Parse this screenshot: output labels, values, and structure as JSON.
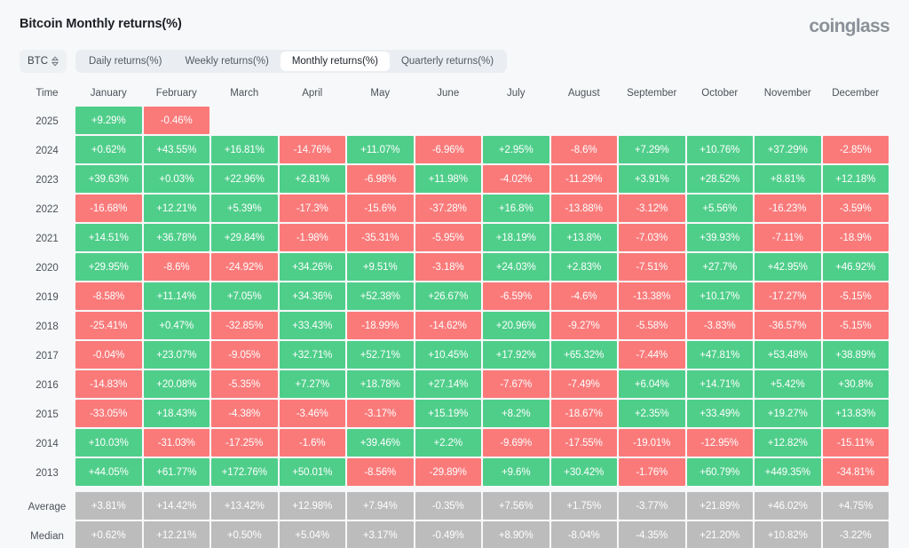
{
  "header": {
    "title": "Bitcoin Monthly returns(%)",
    "brand": "coinglass"
  },
  "controls": {
    "symbol": "BTC",
    "symbol_icon": "updown-chevron-icon",
    "tabs": [
      {
        "label": "Daily returns(%)",
        "active": false
      },
      {
        "label": "Weekly returns(%)",
        "active": false
      },
      {
        "label": "Monthly returns(%)",
        "active": true
      },
      {
        "label": "Quarterly returns(%)",
        "active": false
      }
    ]
  },
  "colors": {
    "positive": "#4fce8a",
    "negative": "#fa7a7a",
    "neutral": "#bcbcbc",
    "background": "#f7f8f9",
    "text": "#4b525a"
  },
  "table": {
    "columns": [
      "Time",
      "January",
      "February",
      "March",
      "April",
      "May",
      "June",
      "July",
      "August",
      "September",
      "October",
      "November",
      "December"
    ],
    "rows": [
      {
        "label": "2025",
        "type": "year",
        "values": [
          "+9.29%",
          "-0.46%",
          "",
          "",
          "",
          "",
          "",
          "",
          "",
          "",
          "",
          ""
        ]
      },
      {
        "label": "2024",
        "type": "year",
        "values": [
          "+0.62%",
          "+43.55%",
          "+16.81%",
          "-14.76%",
          "+11.07%",
          "-6.96%",
          "+2.95%",
          "-8.6%",
          "+7.29%",
          "+10.76%",
          "+37.29%",
          "-2.85%"
        ]
      },
      {
        "label": "2023",
        "type": "year",
        "values": [
          "+39.63%",
          "+0.03%",
          "+22.96%",
          "+2.81%",
          "-6.98%",
          "+11.98%",
          "-4.02%",
          "-11.29%",
          "+3.91%",
          "+28.52%",
          "+8.81%",
          "+12.18%"
        ]
      },
      {
        "label": "2022",
        "type": "year",
        "values": [
          "-16.68%",
          "+12.21%",
          "+5.39%",
          "-17.3%",
          "-15.6%",
          "-37.28%",
          "+16.8%",
          "-13.88%",
          "-3.12%",
          "+5.56%",
          "-16.23%",
          "-3.59%"
        ]
      },
      {
        "label": "2021",
        "type": "year",
        "values": [
          "+14.51%",
          "+36.78%",
          "+29.84%",
          "-1.98%",
          "-35.31%",
          "-5.95%",
          "+18.19%",
          "+13.8%",
          "-7.03%",
          "+39.93%",
          "-7.11%",
          "-18.9%"
        ]
      },
      {
        "label": "2020",
        "type": "year",
        "values": [
          "+29.95%",
          "-8.6%",
          "-24.92%",
          "+34.26%",
          "+9.51%",
          "-3.18%",
          "+24.03%",
          "+2.83%",
          "-7.51%",
          "+27.7%",
          "+42.95%",
          "+46.92%"
        ]
      },
      {
        "label": "2019",
        "type": "year",
        "values": [
          "-8.58%",
          "+11.14%",
          "+7.05%",
          "+34.36%",
          "+52.38%",
          "+26.67%",
          "-6.59%",
          "-4.6%",
          "-13.38%",
          "+10.17%",
          "-17.27%",
          "-5.15%"
        ]
      },
      {
        "label": "2018",
        "type": "year",
        "values": [
          "-25.41%",
          "+0.47%",
          "-32.85%",
          "+33.43%",
          "-18.99%",
          "-14.62%",
          "+20.96%",
          "-9.27%",
          "-5.58%",
          "-3.83%",
          "-36.57%",
          "-5.15%"
        ]
      },
      {
        "label": "2017",
        "type": "year",
        "values": [
          "-0.04%",
          "+23.07%",
          "-9.05%",
          "+32.71%",
          "+52.71%",
          "+10.45%",
          "+17.92%",
          "+65.32%",
          "-7.44%",
          "+47.81%",
          "+53.48%",
          "+38.89%"
        ]
      },
      {
        "label": "2016",
        "type": "year",
        "values": [
          "-14.83%",
          "+20.08%",
          "-5.35%",
          "+7.27%",
          "+18.78%",
          "+27.14%",
          "-7.67%",
          "-7.49%",
          "+6.04%",
          "+14.71%",
          "+5.42%",
          "+30.8%"
        ]
      },
      {
        "label": "2015",
        "type": "year",
        "values": [
          "-33.05%",
          "+18.43%",
          "-4.38%",
          "-3.46%",
          "-3.17%",
          "+15.19%",
          "+8.2%",
          "-18.67%",
          "+2.35%",
          "+33.49%",
          "+19.27%",
          "+13.83%"
        ]
      },
      {
        "label": "2014",
        "type": "year",
        "values": [
          "+10.03%",
          "-31.03%",
          "-17.25%",
          "-1.6%",
          "+39.46%",
          "+2.2%",
          "-9.69%",
          "-17.55%",
          "-19.01%",
          "-12.95%",
          "+12.82%",
          "-15.11%"
        ]
      },
      {
        "label": "2013",
        "type": "year",
        "values": [
          "+44.05%",
          "+61.77%",
          "+172.76%",
          "+50.01%",
          "-8.56%",
          "-29.89%",
          "+9.6%",
          "+30.42%",
          "-1.76%",
          "+60.79%",
          "+449.35%",
          "-34.81%"
        ]
      },
      {
        "label": "Average",
        "type": "summary",
        "values": [
          "+3.81%",
          "+14.42%",
          "+13.42%",
          "+12.98%",
          "+7.94%",
          "-0.35%",
          "+7.56%",
          "+1.75%",
          "-3.77%",
          "+21.89%",
          "+46.02%",
          "+4.75%"
        ]
      },
      {
        "label": "Median",
        "type": "summary",
        "values": [
          "+0.62%",
          "+12.21%",
          "+0.50%",
          "+5.04%",
          "+3.17%",
          "-0.49%",
          "+8.90%",
          "-8.04%",
          "-4.35%",
          "+21.20%",
          "+10.82%",
          "-3.22%"
        ]
      }
    ]
  }
}
